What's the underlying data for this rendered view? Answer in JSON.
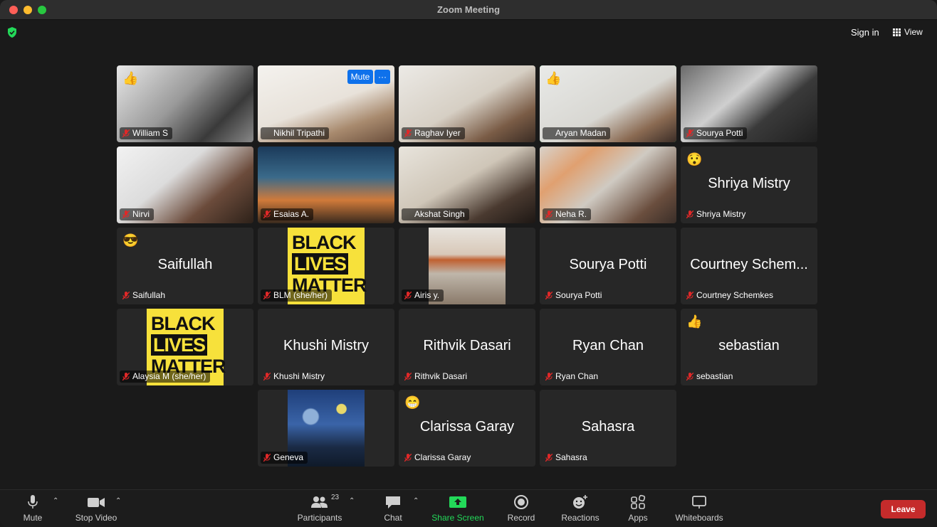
{
  "window": {
    "title": "Zoom Meeting"
  },
  "header": {
    "sign_in": "Sign in",
    "view": "View"
  },
  "tiles": [
    {
      "name": "William S",
      "reaction": "👍"
    },
    {
      "name": "Nikhil Tripathi",
      "mute_label": "Mute",
      "more_label": "···"
    },
    {
      "name": "Raghav Iyer"
    },
    {
      "name": "Aryan Madan",
      "reaction": "👍"
    },
    {
      "name": "Sourya Potti"
    },
    {
      "name": "Nirvi"
    },
    {
      "name": "Esaias A."
    },
    {
      "name": "Akshat Singh"
    },
    {
      "name": "Neha R."
    },
    {
      "name": "Shriya Mistry",
      "display": "Shriya Mistry",
      "reaction": "😯"
    },
    {
      "name": "Saifullah",
      "display": "Saifullah",
      "reaction": "😎"
    },
    {
      "name": "BLM (she/her)",
      "blm": [
        "BLACK",
        "LIVES",
        "MATTER"
      ]
    },
    {
      "name": "Airis y."
    },
    {
      "name": "Sourya Potti",
      "display": "Sourya Potti"
    },
    {
      "name": "Courtney Schemkes",
      "display": "Courtney Schem..."
    },
    {
      "name": "Alaysia M (she/her)",
      "blm": [
        "BLACK",
        "LIVES",
        "MATTER"
      ]
    },
    {
      "name": "Khushi Mistry",
      "display": "Khushi Mistry"
    },
    {
      "name": "Rithvik Dasari",
      "display": "Rithvik Dasari"
    },
    {
      "name": "Ryan Chan",
      "display": "Ryan Chan"
    },
    {
      "name": "sebastian",
      "display": "sebastian",
      "reaction": "👍"
    },
    {
      "name": "Geneva"
    },
    {
      "name": "Clarissa Garay",
      "display": "Clarissa Garay",
      "reaction": "😁"
    },
    {
      "name": "Sahasra",
      "display": "Sahasra"
    }
  ],
  "toolbar": {
    "mute": "Mute",
    "stop_video": "Stop Video",
    "participants": "Participants",
    "participants_count": "23",
    "chat": "Chat",
    "share_screen": "Share Screen",
    "record": "Record",
    "reactions": "Reactions",
    "apps": "Apps",
    "whiteboards": "Whiteboards",
    "leave": "Leave"
  },
  "colors": {
    "accent_green": "#23d959",
    "leave_red": "#c52b2b",
    "share_green": "#23d959",
    "button_blue": "#0e71eb"
  }
}
